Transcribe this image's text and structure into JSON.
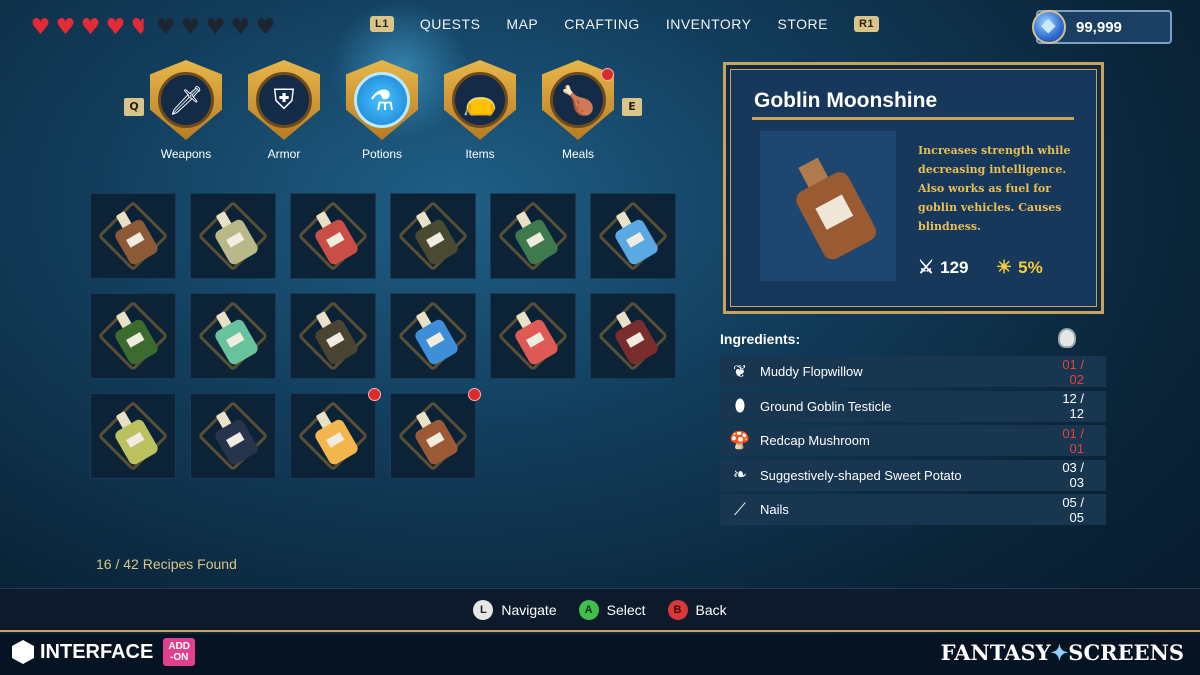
{
  "hud": {
    "hearts": [
      "full",
      "full",
      "full",
      "full",
      "half",
      "empty",
      "empty",
      "empty",
      "empty",
      "empty"
    ],
    "currency_amount": "99,999"
  },
  "topnav": {
    "left_shoulder": "L1",
    "right_shoulder": "R1",
    "tabs": [
      "QUESTS",
      "MAP",
      "CRAFTING",
      "INVENTORY",
      "STORE"
    ]
  },
  "categories": {
    "prev_key": "Q",
    "next_key": "E",
    "items": [
      {
        "label": "Weapons",
        "icon": "sword-icon",
        "glyph": "🗡"
      },
      {
        "label": "Armor",
        "icon": "armor-icon",
        "glyph": "⛨"
      },
      {
        "label": "Potions",
        "icon": "potion-icon",
        "glyph": "⚗"
      },
      {
        "label": "Items",
        "icon": "bag-icon",
        "glyph": "👝"
      },
      {
        "label": "Meals",
        "icon": "drumstick-icon",
        "glyph": "🍗"
      }
    ],
    "active": "Potions"
  },
  "recipes": {
    "bottles": [
      {
        "color": "#8c5a36",
        "new": false
      },
      {
        "color": "#b9b888",
        "new": false
      },
      {
        "color": "#c94e45",
        "new": false
      },
      {
        "color": "#4a4a32",
        "new": false
      },
      {
        "color": "#3f7a4e",
        "new": false
      },
      {
        "color": "#5aa9e2",
        "new": false
      },
      {
        "color": "#3b6b2e",
        "new": false
      },
      {
        "color": "#69c29e",
        "new": false
      },
      {
        "color": "#4b4433",
        "new": false
      },
      {
        "color": "#3f8ed8",
        "new": false
      },
      {
        "color": "#df5a55",
        "new": false
      },
      {
        "color": "#7a2d2d",
        "new": false
      },
      {
        "color": "#bcc15f",
        "new": false
      },
      {
        "color": "#27344e",
        "new": false
      },
      {
        "color": "#f2b64c",
        "new": true
      },
      {
        "color": "#9b5a35",
        "new": true
      }
    ],
    "found_text": "16 / 42 Recipes Found"
  },
  "detail": {
    "title": "Goblin Moonshine",
    "description": "Increases strength while decreasing intelligence. Also works as fuel for goblin vehicles.  Causes blindness.",
    "attack": "129",
    "chance": "5%"
  },
  "ingredients": {
    "heading": "Ingredients:",
    "items": [
      {
        "name": "Muddy Flopwillow",
        "count": "01 / 02",
        "short": true,
        "icon": "herb-icon",
        "glyph": "❦"
      },
      {
        "name": "Ground Goblin Testicle",
        "count": "12 / 12",
        "short": false,
        "icon": "testicle-icon",
        "glyph": "⬮"
      },
      {
        "name": "Redcap Mushroom",
        "count": "01 / 01",
        "short": true,
        "icon": "mushroom-icon",
        "glyph": "🍄"
      },
      {
        "name": "Suggestively-shaped Sweet Potato",
        "count": "03 / 03",
        "short": false,
        "icon": "potato-icon",
        "glyph": "❧"
      },
      {
        "name": "Nails",
        "count": "05 / 05",
        "short": false,
        "icon": "nail-icon",
        "glyph": "⟋"
      }
    ]
  },
  "hints": {
    "navigate": {
      "button": "L",
      "label": "Navigate"
    },
    "select": {
      "button": "A",
      "label": "Select"
    },
    "back": {
      "button": "B",
      "label": "Back"
    }
  },
  "footer": {
    "brand_left": "INTERFACE",
    "addon_line1": "ADD",
    "addon_line2": "-ON",
    "brand_right_a": "FANTASY",
    "brand_right_b": "SCREENS"
  },
  "colors": {
    "accent_gold": "#caa35a",
    "short_red": "#e04343",
    "heart_red": "#e32b38",
    "desc_gold": "#e7bf55"
  }
}
